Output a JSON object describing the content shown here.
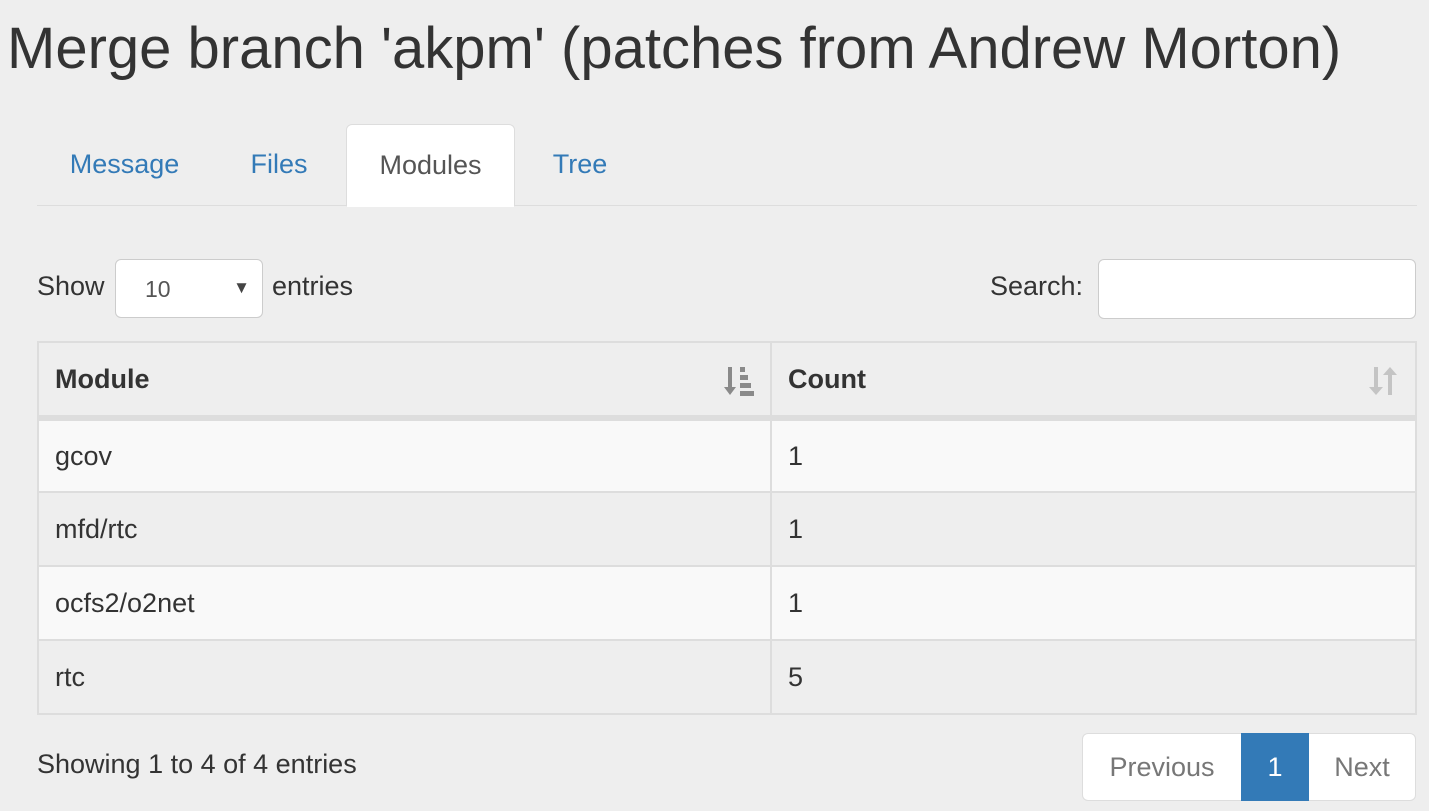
{
  "page": {
    "title": "Merge branch 'akpm' (patches from Andrew Morton)"
  },
  "tabs": [
    {
      "label": "Message",
      "active": false
    },
    {
      "label": "Files",
      "active": false
    },
    {
      "label": "Modules",
      "active": true
    },
    {
      "label": "Tree",
      "active": false
    }
  ],
  "length_control": {
    "prefix": "Show",
    "selected": "10",
    "suffix": "entries"
  },
  "search": {
    "label": "Search:",
    "value": ""
  },
  "table": {
    "columns": [
      {
        "label": "Module",
        "sort": "ascending",
        "sort_icon": "sort-amount-asc-icon"
      },
      {
        "label": "Count",
        "sort": "none",
        "sort_icon": "sort-both-icon"
      }
    ],
    "rows": [
      {
        "module": "gcov",
        "count": "1"
      },
      {
        "module": "mfd/rtc",
        "count": "1"
      },
      {
        "module": "ocfs2/o2net",
        "count": "1"
      },
      {
        "module": "rtc",
        "count": "5"
      }
    ]
  },
  "info": "Showing 1 to 4 of 4 entries",
  "pagination": {
    "previous": "Previous",
    "current": "1",
    "next": "Next"
  },
  "colors": {
    "link": "#337ab7",
    "active_page": "#337ab7",
    "background": "#eeeeee"
  }
}
